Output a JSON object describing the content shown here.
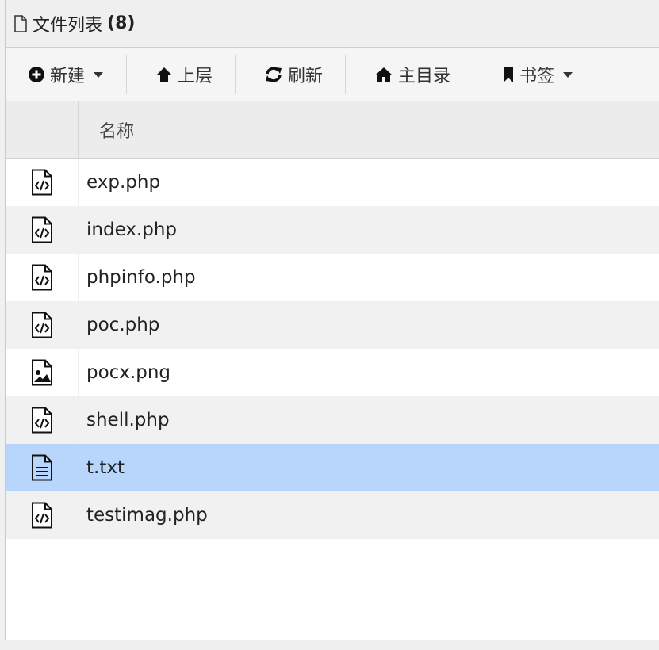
{
  "window": {
    "title": "文件列表",
    "count": "(8)"
  },
  "toolbar": {
    "new_label": "新建",
    "up_label": "上层",
    "refresh_label": "刷新",
    "home_label": "主目录",
    "bookmark_label": "书签"
  },
  "table": {
    "header_name": "名称"
  },
  "files": [
    {
      "name": "exp.php",
      "icon": "code-file-icon"
    },
    {
      "name": "index.php",
      "icon": "code-file-icon"
    },
    {
      "name": "phpinfo.php",
      "icon": "code-file-icon"
    },
    {
      "name": "poc.php",
      "icon": "code-file-icon"
    },
    {
      "name": "pocx.png",
      "icon": "image-file-icon"
    },
    {
      "name": "shell.php",
      "icon": "code-file-icon"
    },
    {
      "name": "t.txt",
      "icon": "text-file-icon"
    },
    {
      "name": "testimag.php",
      "icon": "code-file-icon"
    }
  ],
  "selected_file": "t.txt",
  "colors": {
    "selected_row": "#b8d6fb",
    "alt_row": "#f1f1f1"
  }
}
